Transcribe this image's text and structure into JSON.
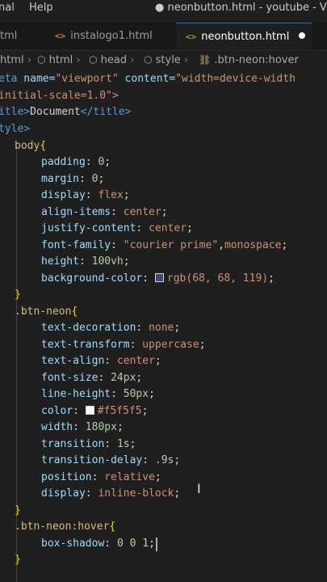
{
  "titlebar": {
    "menu_terminal": "nal",
    "menu_help": "Help",
    "window_title": "● neonbutton.html - youtube - Visual"
  },
  "tabs": [
    {
      "label": "tml",
      "icon": "<>",
      "active": false
    },
    {
      "label": "instalogo1.html",
      "icon": "<>",
      "active": false
    },
    {
      "label": "neonbutton.html",
      "icon": "<>",
      "active": true,
      "dirty": true
    }
  ],
  "breadcrumb": {
    "items": [
      "html",
      "html",
      "head",
      "style",
      ".btn-neon:hover"
    ]
  },
  "colors": {
    "bg_swatch": "#444477",
    "color_swatch": "#f5f5f5"
  },
  "code": {
    "l1": {
      "tag": "eta",
      "attr1": " name=",
      "val1": "\"viewport\"",
      "attr2": " content=",
      "val2": "\"width=device-width"
    },
    "l2": {
      "text": "initial-scale=1.0\">"
    },
    "l3": {
      "open": "itle>",
      "text": "Document",
      "close": "</title>"
    },
    "l4": {
      "tag": "tyle>"
    },
    "l5": {
      "sel": "body",
      "brace": "{"
    },
    "l6": {
      "prop": "padding",
      "num": "0"
    },
    "l7": {
      "prop": "margin",
      "num": "0"
    },
    "l8": {
      "prop": "display",
      "val": "flex"
    },
    "l9": {
      "prop": "align-items",
      "val": "center"
    },
    "l10": {
      "prop": "justify-content",
      "val": "center"
    },
    "l11": {
      "prop": "font-family",
      "str": "\"courier prime\"",
      "val": "monospace"
    },
    "l12": {
      "prop": "height",
      "num": "100vh"
    },
    "l13": {
      "prop": "background-color",
      "val": "rgb(68, 68, 119)"
    },
    "l14": {
      "brace": "}"
    },
    "l15": {
      "sel": ".btn-neon",
      "brace": "{"
    },
    "l16": {
      "prop": "text-decoration",
      "val": "none"
    },
    "l17": {
      "prop": "text-transform",
      "val": "uppercase"
    },
    "l18": {
      "prop": "text-align",
      "val": "center"
    },
    "l19": {
      "prop": "font-size",
      "num": "24px"
    },
    "l20": {
      "prop": "line-height",
      "num": "50px"
    },
    "l21": {
      "prop": "color",
      "val": "#f5f5f5"
    },
    "l22": {
      "prop": "width",
      "num": "180px"
    },
    "l23": {
      "prop": "transition",
      "num": "1s"
    },
    "l24": {
      "prop": "transition-delay",
      "num": ".9s"
    },
    "l25": {
      "prop": "position",
      "val": "relative"
    },
    "l26": {
      "prop": "display",
      "val": "inline-block"
    },
    "l27": {
      "brace": "}"
    },
    "l28": {
      "sel": ".btn-neon:hover",
      "brace": "{"
    },
    "l29": {
      "prop": "box-shadow",
      "num": "0 0 1"
    },
    "l30": {
      "brace": "}"
    }
  }
}
